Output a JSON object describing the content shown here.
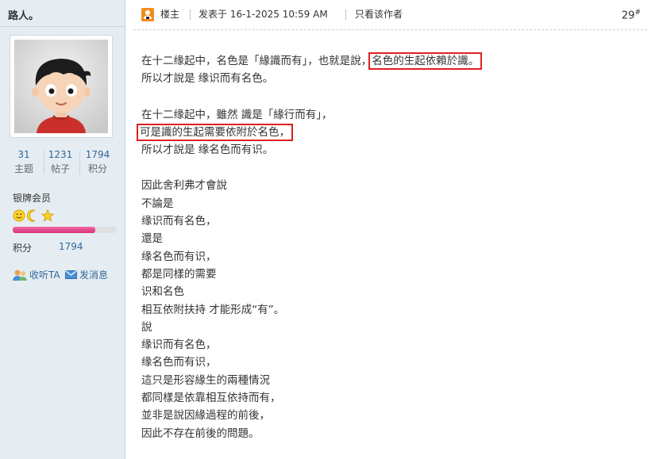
{
  "author": {
    "name": "路人。",
    "stats": [
      {
        "value": "31",
        "label": "主题"
      },
      {
        "value": "1231",
        "label": "帖子"
      },
      {
        "value": "1794",
        "label": "积分"
      }
    ],
    "rank": "银牌会员",
    "credit_label": "积分",
    "credit_value": "1794",
    "progress": 0.8,
    "follow_label": "收听TA",
    "message_label": "发消息"
  },
  "post": {
    "role": "楼主",
    "posted_at": "发表于 16-1-2025 10:59 AM",
    "author_only": "只看该作者",
    "floor": "29",
    "floor_suffix": "#"
  },
  "content": {
    "l1a": "在十二缘起中，名色是「緣識而有」，也就是說，",
    "l1b": "名色的生起依賴於識。",
    "l2": "所以才說是 缘识而有名色。",
    "l3": "在十二缘起中，雖然 識是「緣行而有」，",
    "l4": "可是識的生起需要依附於名色，",
    "l5": "所以才說是 缘名色而有识。",
    "l6": "因此舍利弗才會說",
    "l7": "不論是",
    "l8": "缘识而有名色，",
    "l9": "還是",
    "l10": "缘名色而有识，",
    "l11": "都是同樣的需要",
    "l12": "识和名色",
    "l13": "相互依附扶持 才能形成“有”。",
    "l14": "說",
    "l15": "缘识而有名色，",
    "l16": "缘名色而有识，",
    "l17": "這只是形容緣生的兩種情況",
    "l18": "都同樣是依靠相互依持而有，",
    "l19": "並非是說因緣過程的前後，",
    "l20": "因此不存在前後的問題。"
  },
  "colors": {
    "sidebar_bg": "#e5edf2",
    "link": "#336699",
    "highlight_box": "#e02020",
    "progress_fill": "#d9317a"
  },
  "icons": [
    "avatar-cartoon-boy",
    "floor-owner-icon",
    "smiley-icon",
    "moon-icon",
    "star-icon",
    "follow-icon",
    "envelope-icon"
  ]
}
